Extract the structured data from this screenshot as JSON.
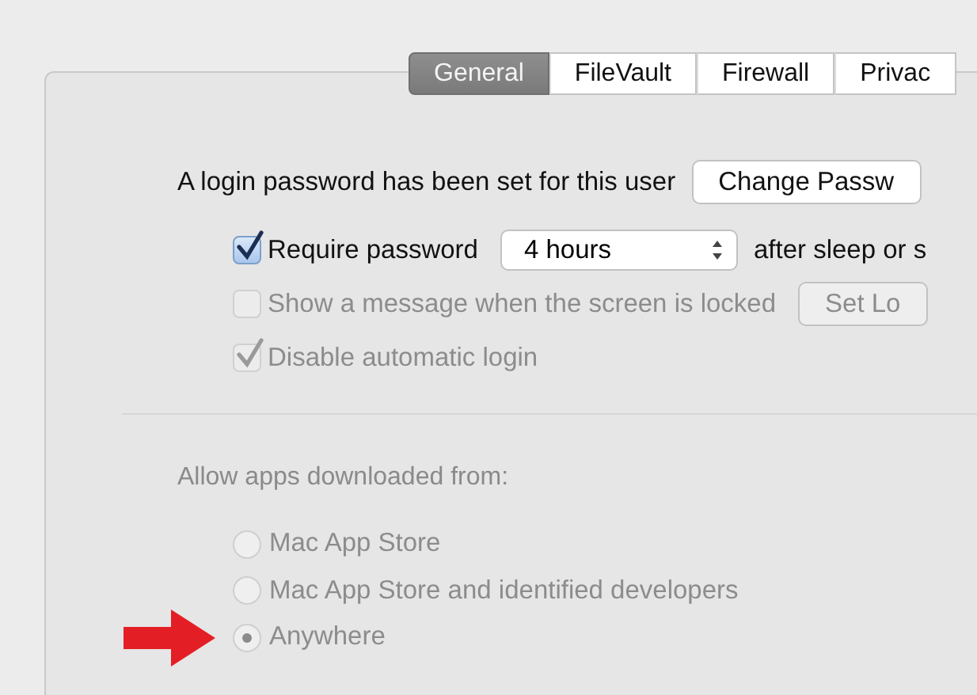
{
  "tabs": [
    {
      "label": "General",
      "selected": true
    },
    {
      "label": "FileVault",
      "selected": false
    },
    {
      "label": "Firewall",
      "selected": false
    },
    {
      "label": "Privac",
      "selected": false
    }
  ],
  "login": {
    "text": "A login password has been set for this user",
    "button": "Change Passw"
  },
  "options": [
    {
      "kind": "select",
      "label": "Require password",
      "checked": true,
      "disabled": false,
      "value": "4 hours",
      "after": "after sleep or s"
    },
    {
      "kind": "button",
      "label": "Show a message when the screen is locked",
      "checked": false,
      "disabled": true,
      "button": "Set Lo"
    },
    {
      "kind": "plain",
      "label": "Disable automatic login",
      "checked": true,
      "disabled": true
    }
  ],
  "allow": {
    "heading": "Allow apps downloaded from:",
    "choices": [
      {
        "label": "Mac App Store",
        "selected": false,
        "disabled": true,
        "arrow": false
      },
      {
        "label": "Mac App Store and identified developers",
        "selected": false,
        "disabled": true,
        "arrow": false
      },
      {
        "label": "Anywhere",
        "selected": true,
        "disabled": true,
        "arrow": true
      }
    ]
  }
}
